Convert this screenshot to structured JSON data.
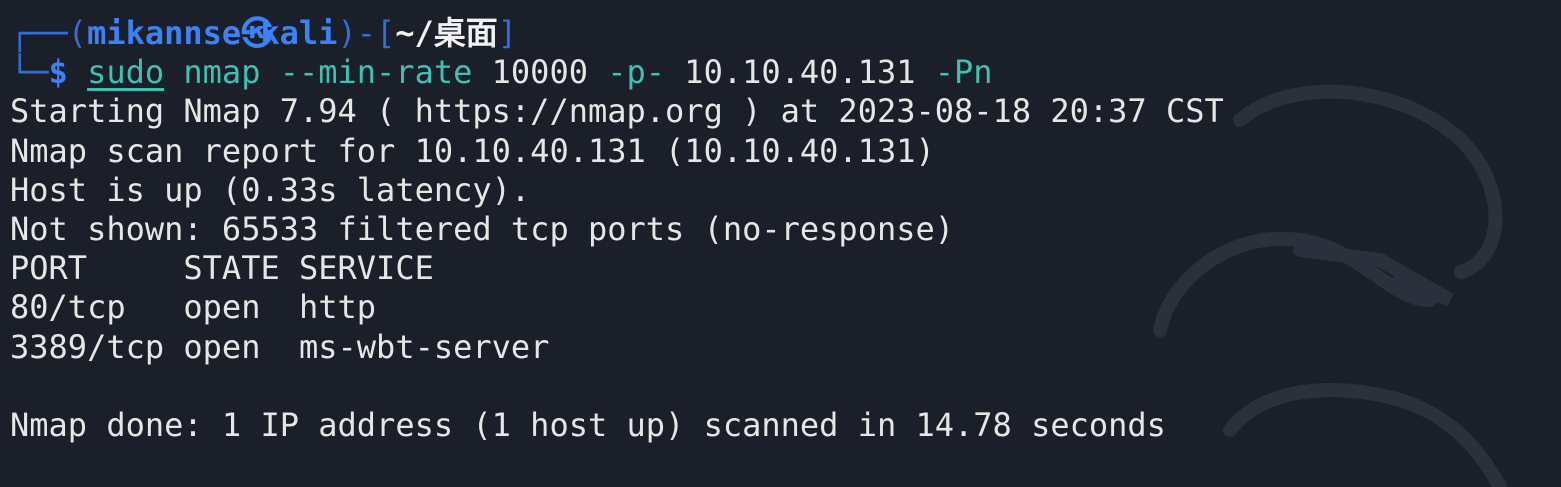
{
  "prompt": {
    "top_left": "┌──(",
    "user": "mikannse",
    "symbol": "㉿",
    "host": "kali",
    "mid": ")-[",
    "path": "~/桌面",
    "close": "]",
    "bottom_left": "└─",
    "dollar": "$"
  },
  "command": {
    "sudo": "sudo",
    "program": "nmap",
    "flag_min_rate": "--min-rate",
    "min_rate_value": "10000",
    "flag_ports": "-p-",
    "target": "10.10.40.131",
    "flag_pn": "-Pn"
  },
  "output": [
    "Starting Nmap 7.94 ( https://nmap.org ) at 2023-08-18 20:37 CST",
    "Nmap scan report for 10.10.40.131 (10.10.40.131)",
    "Host is up (0.33s latency).",
    "Not shown: 65533 filtered tcp ports (no-response)",
    "PORT     STATE SERVICE",
    "80/tcp   open  http",
    "3389/tcp open  ms-wbt-server",
    "",
    "Nmap done: 1 IP address (1 host up) scanned in 14.78 seconds"
  ],
  "colors": {
    "background": "#1a1f29",
    "prompt_blue": "#3b82f6",
    "command_teal": "#3ec1b0",
    "text": "#e6e6e6"
  }
}
